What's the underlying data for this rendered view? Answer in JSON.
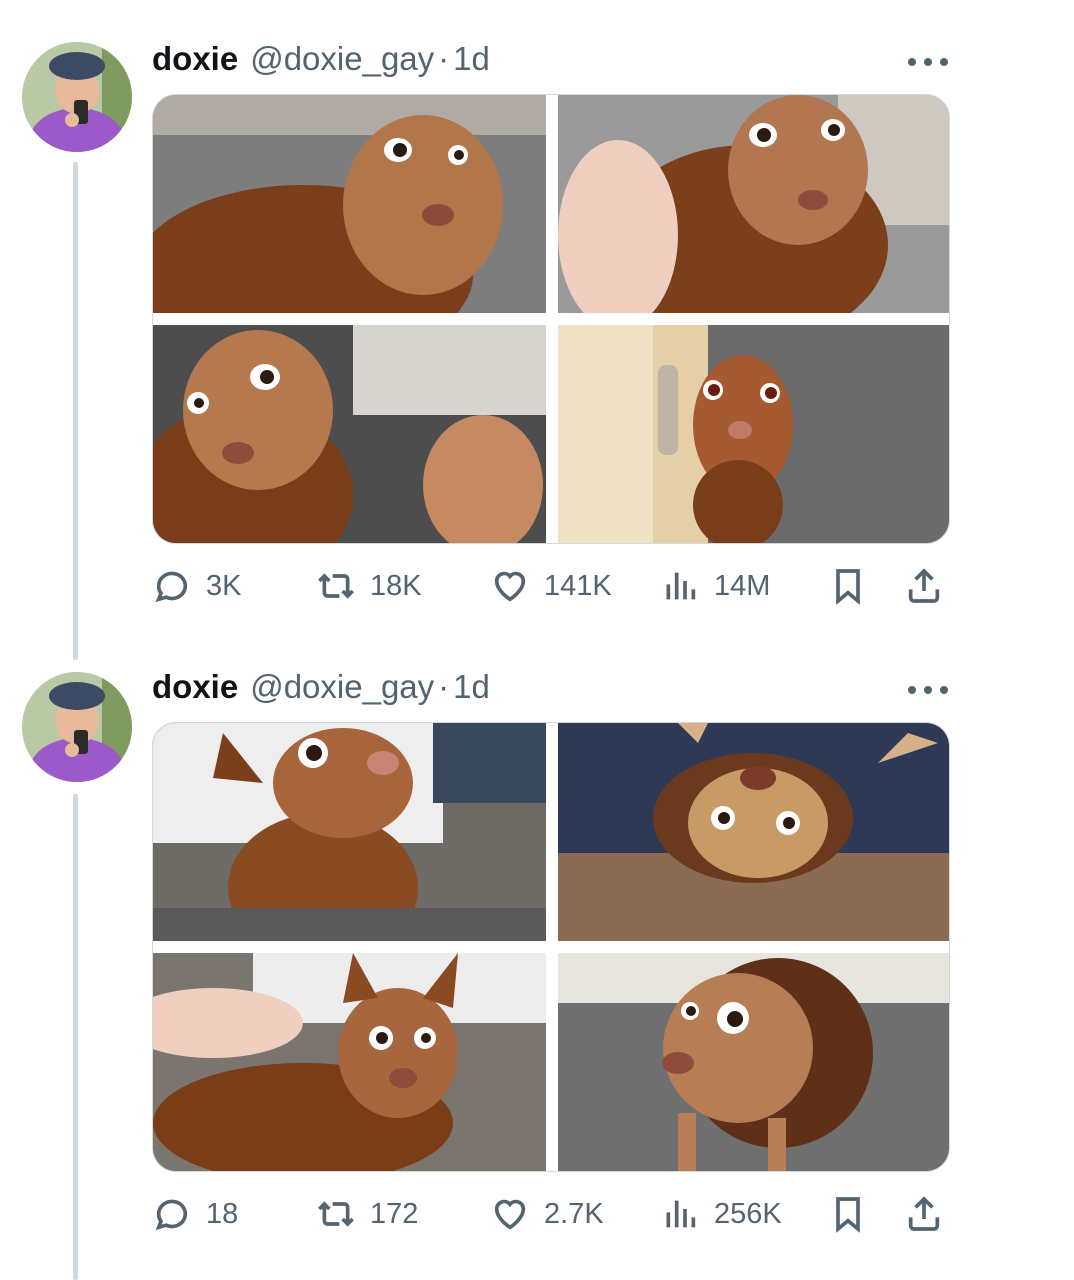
{
  "tweets": [
    {
      "name": "doxie",
      "handle": "@doxie_gay",
      "dot": "·",
      "time": "1d",
      "stats": {
        "replies": "3K",
        "retweets": "18K",
        "likes": "141K",
        "views": "14M"
      }
    },
    {
      "name": "doxie",
      "handle": "@doxie_gay",
      "dot": "·",
      "time": "1d",
      "stats": {
        "replies": "18",
        "retweets": "172",
        "likes": "2.7K",
        "views": "256K"
      }
    }
  ],
  "icons": {
    "reply": "speech-bubble-icon",
    "retweet": "retweet-arrows-icon",
    "like": "heart-icon",
    "views": "bar-chart-icon",
    "bookmark": "bookmark-icon",
    "share": "share-upload-icon",
    "more": "ellipsis-icon"
  },
  "colors": {
    "text": "#0f1419",
    "secondary": "#536471",
    "border": "#cfd9de",
    "background": "#ffffff"
  }
}
